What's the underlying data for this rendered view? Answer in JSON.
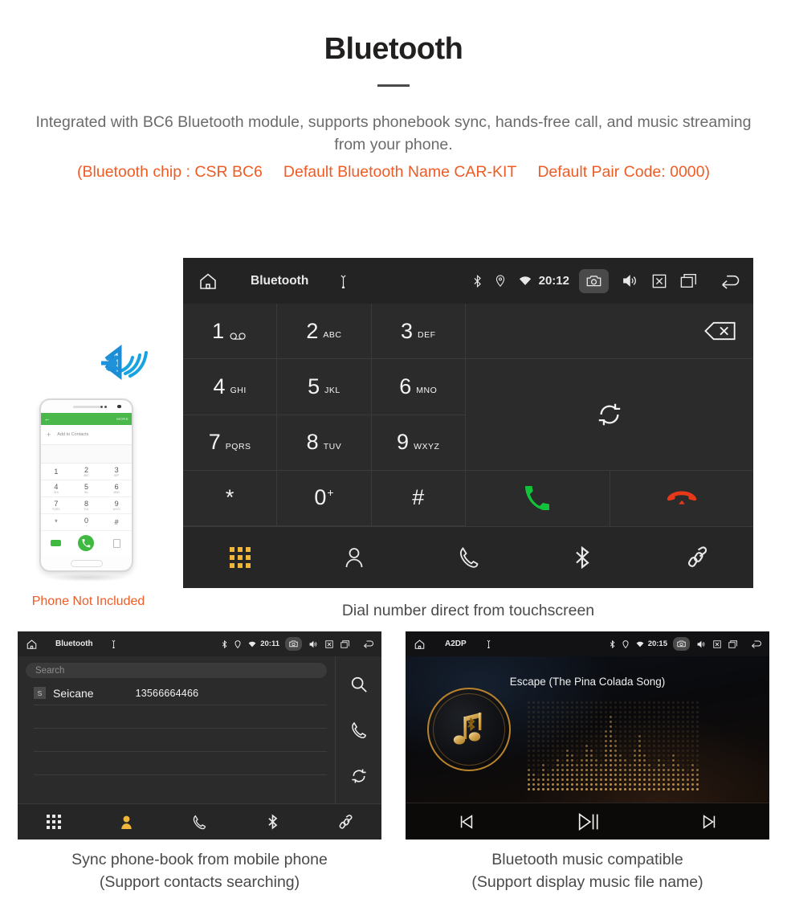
{
  "header": {
    "title": "Bluetooth",
    "intro": "Integrated with BC6 Bluetooth module, supports phonebook sync, hands-free call, and music streaming from your phone.",
    "specs": [
      "(Bluetooth chip : CSR BC6",
      "Default Bluetooth Name CAR-KIT",
      "Default Pair Code: 0000)"
    ],
    "accent_color": "#ef5b25",
    "body_color": "#6b6b6b"
  },
  "dial_screen": {
    "statusbar": {
      "home_icon": "home-icon",
      "title": "Bluetooth",
      "usb_icon": "usb-icon",
      "bluetooth_icon": "bluetooth-icon",
      "location_icon": "location-icon",
      "wifi_icon": "wifi-icon",
      "time": "20:12",
      "camera_icon": "camera-icon",
      "volume_icon": "volume-icon",
      "close_icon": "close-icon",
      "recents_icon": "recents-icon",
      "back_icon": "back-icon"
    },
    "keys": [
      {
        "num": "1",
        "sub": "",
        "voicemail": true
      },
      {
        "num": "2",
        "sub": "ABC"
      },
      {
        "num": "3",
        "sub": "DEF"
      },
      {
        "num": "4",
        "sub": "GHI"
      },
      {
        "num": "5",
        "sub": "JKL"
      },
      {
        "num": "6",
        "sub": "MNO"
      },
      {
        "num": "7",
        "sub": "PQRS"
      },
      {
        "num": "8",
        "sub": "TUV"
      },
      {
        "num": "9",
        "sub": "WXYZ"
      },
      {
        "num": "*",
        "sub": ""
      },
      {
        "num": "0",
        "sup": "+"
      },
      {
        "num": "#",
        "sub": ""
      }
    ],
    "number_input": "",
    "backspace_icon": "backspace-icon",
    "sync_icon": "sync-icon",
    "answer_icon": "call-answer-icon",
    "hangup_icon": "call-hangup-icon",
    "answer_color": "#13c23b",
    "hangup_color": "#e8381a",
    "navbar": [
      {
        "icon": "dialpad-icon",
        "active": true
      },
      {
        "icon": "contacts-icon",
        "active": false
      },
      {
        "icon": "call-history-icon",
        "active": false
      },
      {
        "icon": "bluetooth-icon",
        "active": false
      },
      {
        "icon": "link-icon",
        "active": false
      }
    ],
    "active_color": "#f0b63c",
    "caption": "Dial number direct from touchscreen"
  },
  "phone_mockup": {
    "screen_bar_back_icon": "back-arrow-icon",
    "screen_bar_more": "MORE",
    "add_to_contacts": "Add to Contacts",
    "keys": [
      {
        "n": "1",
        "s": ""
      },
      {
        "n": "2",
        "s": "ABC"
      },
      {
        "n": "3",
        "s": "DEF"
      },
      {
        "n": "4",
        "s": "GHI"
      },
      {
        "n": "5",
        "s": "JKL"
      },
      {
        "n": "6",
        "s": "MNO"
      },
      {
        "n": "7",
        "s": "PQRS"
      },
      {
        "n": "8",
        "s": "TUV"
      },
      {
        "n": "9",
        "s": "WXYZ"
      },
      {
        "n": "*",
        "s": ""
      },
      {
        "n": "0",
        "s": "+"
      },
      {
        "n": "#",
        "s": ""
      }
    ],
    "call_icon": "call-answer-icon",
    "bluetooth_signal_icon": "bluetooth-signal-icon",
    "bluetooth_signal_color": "#17a3e0",
    "note": "Phone Not Included",
    "note_color": "#ef5b25"
  },
  "phonebook_screen": {
    "statusbar": {
      "title": "Bluetooth",
      "time": "20:11"
    },
    "search_placeholder": "Search",
    "contacts": [
      {
        "initial": "S",
        "name": "Seicane",
        "number": "13566664466"
      }
    ],
    "empty_rows": 3,
    "side_actions": [
      {
        "icon": "search-icon"
      },
      {
        "icon": "call-history-icon"
      },
      {
        "icon": "sync-icon"
      }
    ],
    "navbar": [
      {
        "icon": "dialpad-icon",
        "active": false
      },
      {
        "icon": "contacts-icon",
        "active": true
      },
      {
        "icon": "call-history-icon",
        "active": false
      },
      {
        "icon": "bluetooth-icon",
        "active": false
      },
      {
        "icon": "link-icon",
        "active": false
      }
    ],
    "caption_line1": "Sync phone-book from mobile phone",
    "caption_line2": "(Support contacts searching)"
  },
  "music_screen": {
    "statusbar": {
      "title": "A2DP",
      "time": "20:15"
    },
    "song_title": "Escape (The Pina Colada Song)",
    "album_icon": "music-note-bluetooth-icon",
    "equalizer_icon": "equalizer-dots",
    "gold_color": "#d3a14a",
    "controls": [
      {
        "icon": "previous-track-icon"
      },
      {
        "icon": "play-pause-icon"
      },
      {
        "icon": "next-track-icon"
      }
    ],
    "caption_line1": "Bluetooth music compatible",
    "caption_line2": "(Support display music file name)"
  }
}
